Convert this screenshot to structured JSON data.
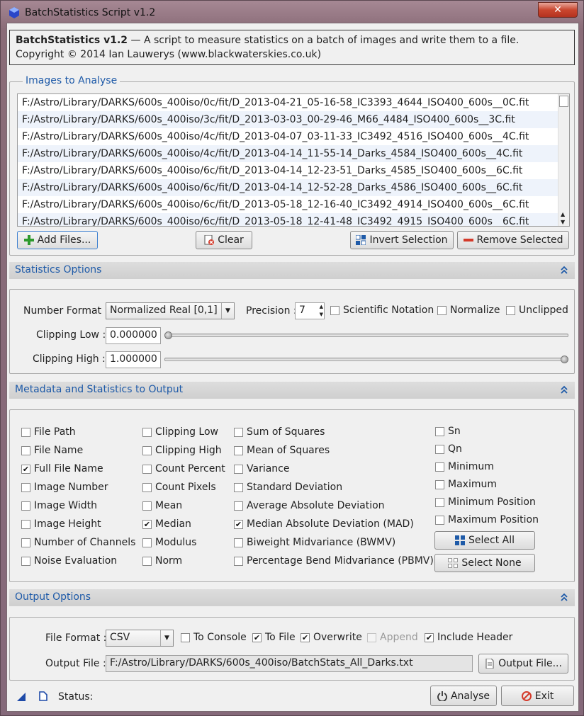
{
  "window": {
    "title": "BatchStatistics Script v1.2",
    "close_label": "✕"
  },
  "header": {
    "name": "BatchStatistics v1.2",
    "description": " — A script to measure statistics on a batch of images and write them to a file.",
    "copyright": "Copyright © 2014 Ian Lauwerys (www.blackwaterskies.co.uk)"
  },
  "images": {
    "title": "Images to Analyse",
    "files": [
      "F:/Astro/Library/DARKS/600s_400iso/0c/fit/D_2013-04-21_05-16-58_IC3393_4644_ISO400_600s__0C.fit",
      "F:/Astro/Library/DARKS/600s_400iso/3c/fit/D_2013-03-03_00-29-46_M66_4484_ISO400_600s__3C.fit",
      "F:/Astro/Library/DARKS/600s_400iso/4c/fit/D_2013-04-07_03-11-33_IC3492_4516_ISO400_600s__4C.fit",
      "F:/Astro/Library/DARKS/600s_400iso/4c/fit/D_2013-04-14_11-55-14_Darks_4584_ISO400_600s__4C.fit",
      "F:/Astro/Library/DARKS/600s_400iso/6c/fit/D_2013-04-14_12-23-51_Darks_4585_ISO400_600s__6C.fit",
      "F:/Astro/Library/DARKS/600s_400iso/6c/fit/D_2013-04-14_12-52-28_Darks_4586_ISO400_600s__6C.fit",
      "F:/Astro/Library/DARKS/600s_400iso/6c/fit/D_2013-05-18_12-16-40_IC3492_4914_ISO400_600s__6C.fit",
      "F:/Astro/Library/DARKS/600s_400iso/6c/fit/D_2013-05-18_12-41-48_IC3492_4915_ISO400_600s__6C.fit"
    ],
    "add_label": "Add Files...",
    "clear_label": "Clear",
    "invert_label": "Invert Selection",
    "remove_label": "Remove Selected"
  },
  "stats_options": {
    "title": "Statistics Options",
    "number_format_label": "Number Format :",
    "number_format_value": "Normalized Real [0,1]",
    "precision_label": "Precision :",
    "precision_value": "7",
    "scientific_label": "Scientific Notation",
    "normalize_label": "Normalize",
    "unclipped_label": "Unclipped",
    "clip_low_label": "Clipping Low :",
    "clip_low_value": "0.000000",
    "clip_low_level": 0,
    "clip_high_label": "Clipping High :",
    "clip_high_value": "1.000000",
    "clip_high_level": 1
  },
  "metadata": {
    "title": "Metadata and Statistics to Output",
    "col1": [
      {
        "label": "File Path",
        "checked": false
      },
      {
        "label": "File Name",
        "checked": false
      },
      {
        "label": "Full File Name",
        "checked": true
      },
      {
        "label": "Image Number",
        "checked": false
      },
      {
        "label": "Image Width",
        "checked": false
      },
      {
        "label": "Image Height",
        "checked": false
      },
      {
        "label": "Number of Channels",
        "checked": false
      },
      {
        "label": "Noise Evaluation",
        "checked": false
      }
    ],
    "col2": [
      {
        "label": "Clipping Low",
        "checked": false
      },
      {
        "label": "Clipping High",
        "checked": false
      },
      {
        "label": "Count Percent",
        "checked": false
      },
      {
        "label": "Count Pixels",
        "checked": false
      },
      {
        "label": "Mean",
        "checked": false
      },
      {
        "label": "Median",
        "checked": true
      },
      {
        "label": "Modulus",
        "checked": false
      },
      {
        "label": "Norm",
        "checked": false
      }
    ],
    "col3": [
      {
        "label": "Sum of Squares",
        "checked": false
      },
      {
        "label": "Mean of Squares",
        "checked": false
      },
      {
        "label": "Variance",
        "checked": false
      },
      {
        "label": "Standard Deviation",
        "checked": false
      },
      {
        "label": "Average Absolute Deviation",
        "checked": false
      },
      {
        "label": "Median Absolute Deviation (MAD)",
        "checked": true
      },
      {
        "label": "Biweight Midvariance (BWMV)",
        "checked": false
      },
      {
        "label": "Percentage Bend Midvariance (PBMV)",
        "checked": false
      }
    ],
    "col4": [
      {
        "label": "Sn",
        "checked": false
      },
      {
        "label": "Qn",
        "checked": false
      },
      {
        "label": "Minimum",
        "checked": false
      },
      {
        "label": "Maximum",
        "checked": false
      },
      {
        "label": "Minimum Position",
        "checked": false
      },
      {
        "label": "Maximum Position",
        "checked": false
      }
    ],
    "select_all_label": "Select All",
    "select_none_label": "Select None"
  },
  "output": {
    "title": "Output Options",
    "file_format_label": "File Format :",
    "file_format_value": "CSV",
    "to_console_label": "To Console",
    "to_console_checked": false,
    "to_file_label": "To File",
    "to_file_checked": true,
    "overwrite_label": "Overwrite",
    "overwrite_checked": true,
    "append_label": "Append",
    "append_checked": false,
    "include_header_label": "Include Header",
    "include_header_checked": true,
    "output_file_label": "Output File :",
    "output_file_value": "F:/Astro/Library/DARKS/600s_400iso/BatchStats_All_Darks.txt",
    "output_file_button": "Output File..."
  },
  "footer": {
    "status_label": "Status:",
    "analyse_label": "Analyse",
    "exit_label": "Exit"
  },
  "colors": {
    "accent": "#1e5aa8",
    "title_gradient_top": "#a68894",
    "close_red": "#c9462f"
  }
}
